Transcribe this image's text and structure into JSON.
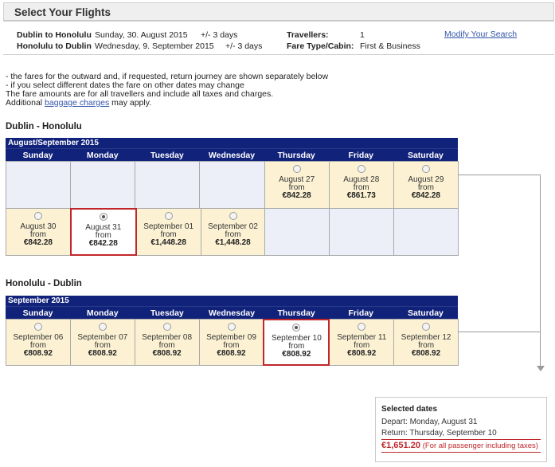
{
  "page": {
    "title": "Select Your Flights"
  },
  "summary": {
    "outbound_route": "Dublin to Honolulu",
    "outbound_date": "Sunday, 30. August 2015",
    "outbound_flex": "+/- 3 days",
    "return_route": "Honolulu to Dublin",
    "return_date": "Wednesday, 9. September 2015",
    "return_flex": "+/- 3 days",
    "travellers_label": "Travellers:",
    "travellers_value": "1",
    "fare_label": "Fare Type/Cabin:",
    "fare_value": "First & Business",
    "modify_link": "Modify Your Search"
  },
  "notes": {
    "line1": "- the fares for the outward and, if requested, return journey are shown separately below",
    "line2": "- if you select different dates the fare on other dates may change",
    "line3": "The fare amounts are for all travellers and include all taxes and charges.",
    "line4_pre": "Additional ",
    "line4_link": "baggage charges",
    "line4_post": " may apply."
  },
  "weekdays": [
    "Sunday",
    "Monday",
    "Tuesday",
    "Wednesday",
    "Thursday",
    "Friday",
    "Saturday"
  ],
  "from_label": "from",
  "outbound": {
    "heading": "Dublin - Honolulu",
    "month_label": "August/September 2015",
    "rows": [
      [
        null,
        null,
        null,
        null,
        {
          "date": "August 27",
          "price": "€842.28",
          "selected": false
        },
        {
          "date": "August 28",
          "price": "€861.73",
          "selected": false
        },
        {
          "date": "August 29",
          "price": "€842.28",
          "selected": false
        }
      ],
      [
        {
          "date": "August 30",
          "price": "€842.28",
          "selected": false
        },
        {
          "date": "August 31",
          "price": "€842.28",
          "selected": true
        },
        {
          "date": "September 01",
          "price": "€1,448.28",
          "selected": false
        },
        {
          "date": "September 02",
          "price": "€1,448.28",
          "selected": false
        },
        null,
        null,
        null
      ]
    ]
  },
  "inbound": {
    "heading": "Honolulu - Dublin",
    "month_label": "September 2015",
    "rows": [
      [
        {
          "date": "September 06",
          "price": "€808.92",
          "selected": false
        },
        {
          "date": "September 07",
          "price": "€808.92",
          "selected": false
        },
        {
          "date": "September 08",
          "price": "€808.92",
          "selected": false
        },
        {
          "date": "September 09",
          "price": "€808.92",
          "selected": false
        },
        {
          "date": "September 10",
          "price": "€808.92",
          "selected": true
        },
        {
          "date": "September 11",
          "price": "€808.92",
          "selected": false
        },
        {
          "date": "September 12",
          "price": "€808.92",
          "selected": false
        }
      ]
    ]
  },
  "selected": {
    "heading": "Selected dates",
    "depart": "Depart: Monday, August 31",
    "return": "Return: Thursday, September 10",
    "total": "€1,651.20",
    "total_note": "(For all passenger including taxes)"
  },
  "colors": {
    "header_navy": "#11227a",
    "fare_cell": "#fcf2d3",
    "empty_cell": "#eceff8",
    "selected_border": "#c0262a",
    "link": "#3355aa"
  }
}
